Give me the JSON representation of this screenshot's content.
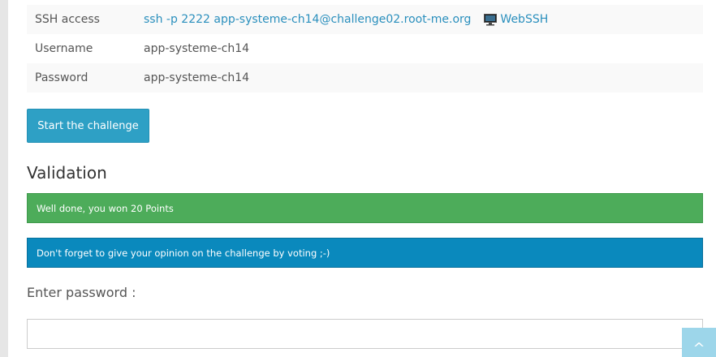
{
  "info": {
    "rows": [
      {
        "label": "SSH access",
        "value": "ssh -p 2222 app-systeme-ch14@challenge02.root-me.org",
        "extra": "WebSSH"
      },
      {
        "label": "Username",
        "value": "app-systeme-ch14"
      },
      {
        "label": "Password",
        "value": "app-systeme-ch14"
      }
    ]
  },
  "start_button": "Start the challenge",
  "validation": {
    "title": "Validation",
    "success_message": "Well done, you won 20 Points",
    "info_message": "Don't forget to give your opinion on the challenge by voting ;-)",
    "password_label": "Enter password :",
    "password_value": ""
  },
  "scroll_top_glyph": "^",
  "colors": {
    "link": "#2a8fbd",
    "button": "#2ea0c5",
    "success": "#4dac5a",
    "info": "#0a89bd",
    "scroll_top": "#9dd6ea"
  },
  "icons": {
    "webssh": "monitor-icon",
    "scroll_top": "scroll-to-top-icon"
  }
}
